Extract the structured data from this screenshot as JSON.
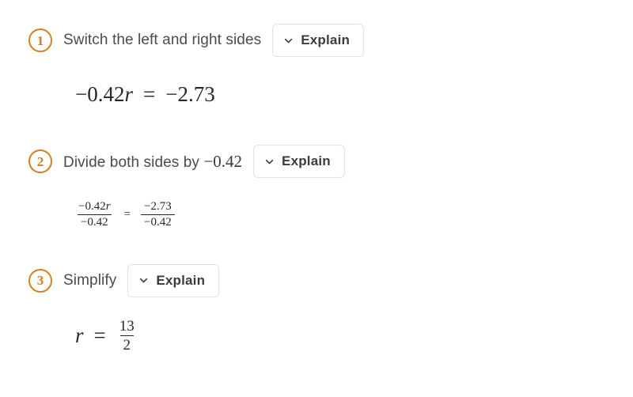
{
  "steps": [
    {
      "number": "1",
      "text": "Switch the left and right sides",
      "math_inline": "",
      "explain_label": "Explain",
      "equation": {
        "lhs_coefficient": "−0.42",
        "lhs_variable": "r",
        "equals": "=",
        "rhs": "−2.73"
      }
    },
    {
      "number": "2",
      "text": "Divide both sides by",
      "math_inline": "−0.42",
      "explain_label": "Explain",
      "equation": {
        "left_numerator": "−0.42",
        "left_numerator_variable": "r",
        "left_denominator": "−0.42",
        "equals": "=",
        "right_numerator": "−2.73",
        "right_denominator": "−0.42"
      }
    },
    {
      "number": "3",
      "text": "Simplify",
      "math_inline": "",
      "explain_label": "Explain",
      "equation": {
        "variable": "r",
        "equals": "=",
        "numerator": "13",
        "denominator": "2"
      }
    }
  ],
  "icons": {
    "chevron": "chevron-down-icon"
  },
  "colors": {
    "badge_orange": "#d2801f",
    "text_gray": "#4b4b4b",
    "math_black": "#272727",
    "button_border": "#e2e2e2",
    "button_label": "#3c3c3c"
  }
}
